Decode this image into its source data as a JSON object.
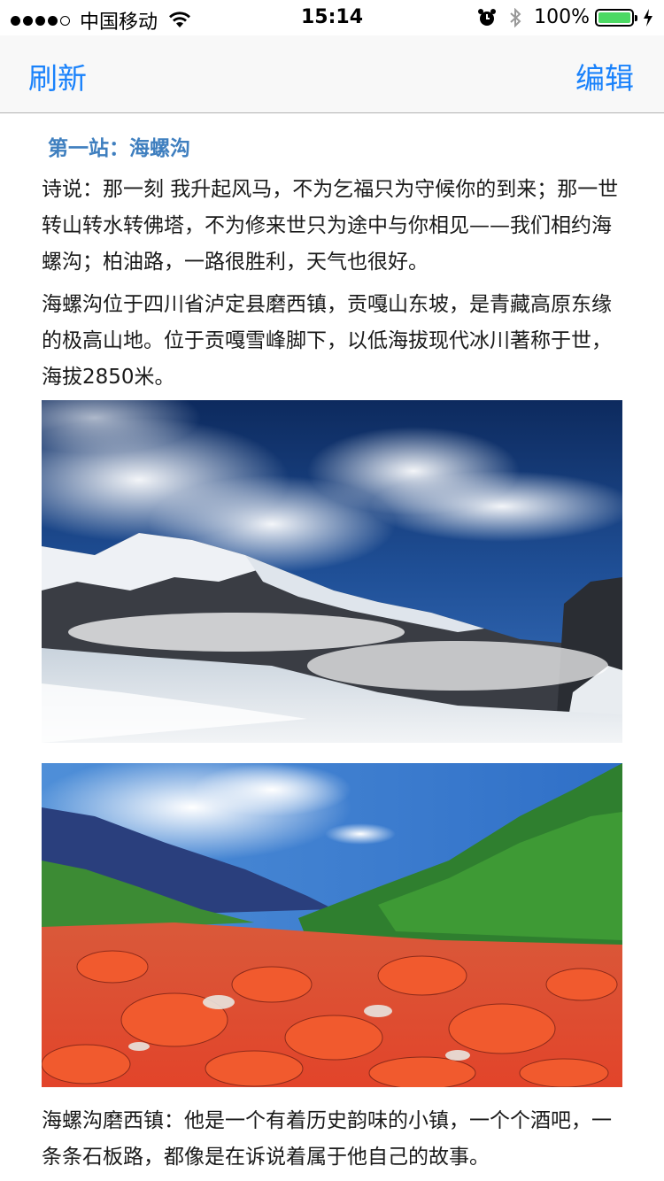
{
  "status_bar": {
    "carrier": "中国移动",
    "time": "15:14",
    "battery_percent": "100%",
    "signal_bars": 4,
    "signal_total": 5,
    "icons": [
      "wifi-icon",
      "alarm-icon",
      "bluetooth-icon",
      "battery-icon",
      "charging-icon"
    ]
  },
  "nav": {
    "left_button": "刷新",
    "right_button": "编辑",
    "accent_color": "#1a82fb"
  },
  "article": {
    "section_title": "第一站：海螺沟",
    "paragraphs": [
      " 诗说：那一刻 我升起风马，不为乞福只为守候你的到来；那一世 转山转水转佛塔，不为修来世只为途中与你相见——我们相约海螺沟；柏油路，一路很胜利，天气也很好。",
      " 海螺沟位于四川省泸定县磨西镇，贡嘎山东坡，是青藏高原东缘的极高山地。位于贡嘎雪峰脚下，以低海拔现代冰川著称于世，海拔2850米。",
      "海螺沟磨西镇：他是一个有着历史韵味的小镇，一个个酒吧，一条条石板路，都像是在诉说着属于他自己的故事。"
    ],
    "images": [
      "snow-mountain-glacier-photo",
      "red-stone-valley-photo"
    ],
    "title_color": "#3f7fbf"
  }
}
